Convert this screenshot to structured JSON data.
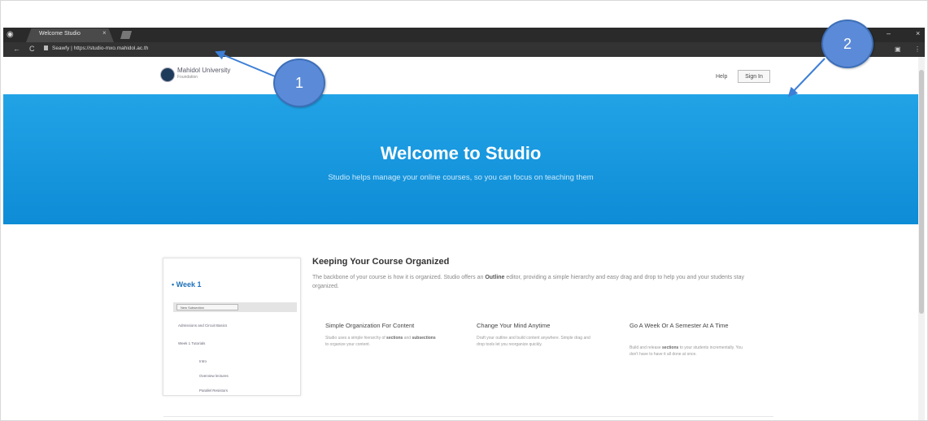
{
  "browser": {
    "tab_title": "Welcome Studio",
    "tab_close": "×",
    "url": "Seawfy | https://studio-mxo.mahidol.ac.th",
    "window_controls": [
      "–",
      "×"
    ],
    "nav_back": "←",
    "nav_reload": "C"
  },
  "header": {
    "logo_name": "Mahidol University",
    "logo_sub": "Foundation",
    "help": "Help",
    "sign_in": "Sign In"
  },
  "hero": {
    "title": "Welcome to Studio",
    "subtitle": "Studio helps manage your online courses, so you can focus on teaching them"
  },
  "feature": {
    "title": "Keeping Your Course Organized",
    "body_1": "The backbone of your course is how it is organized. Studio offers an ",
    "body_bold": "Outline",
    "body_2": " editor, providing a simple hierarchy and easy drag and drop to help you and your students stay organized.",
    "columns": [
      {
        "title": "Simple Organization For Content",
        "body_1": "Studio uses a simple hierarchy of ",
        "bold_1": "sections",
        "body_2": " and ",
        "bold_2": "subsections",
        "body_3": " to organize your content."
      },
      {
        "title": "Change Your Mind Anytime",
        "body_1": "Draft your outline and build content anywhere. Simple drag and drop tools let you reorganize quickly.",
        "bold_1": "",
        "body_2": "",
        "bold_2": "",
        "body_3": ""
      },
      {
        "title": "Go A Week Or A Semester At A Time",
        "body_1": "Build and release ",
        "bold_1": "sections",
        "body_2": " to your students incrementally. You don't have to have it all done at once.",
        "bold_2": "",
        "body_3": ""
      }
    ]
  },
  "screenshot_preview": {
    "week": "• Week 1",
    "new_subsection": "New Subsection",
    "rows": [
      "Admissions and Circuit Basics",
      "Week 1 Tutorials",
      "Intro",
      "Overview lectures",
      "Parallel Resistors"
    ]
  },
  "callouts": [
    "1",
    "2"
  ],
  "colors": {
    "hero": "#1a9be0",
    "callout": "#5b8bd8",
    "link": "#1f72b8"
  }
}
